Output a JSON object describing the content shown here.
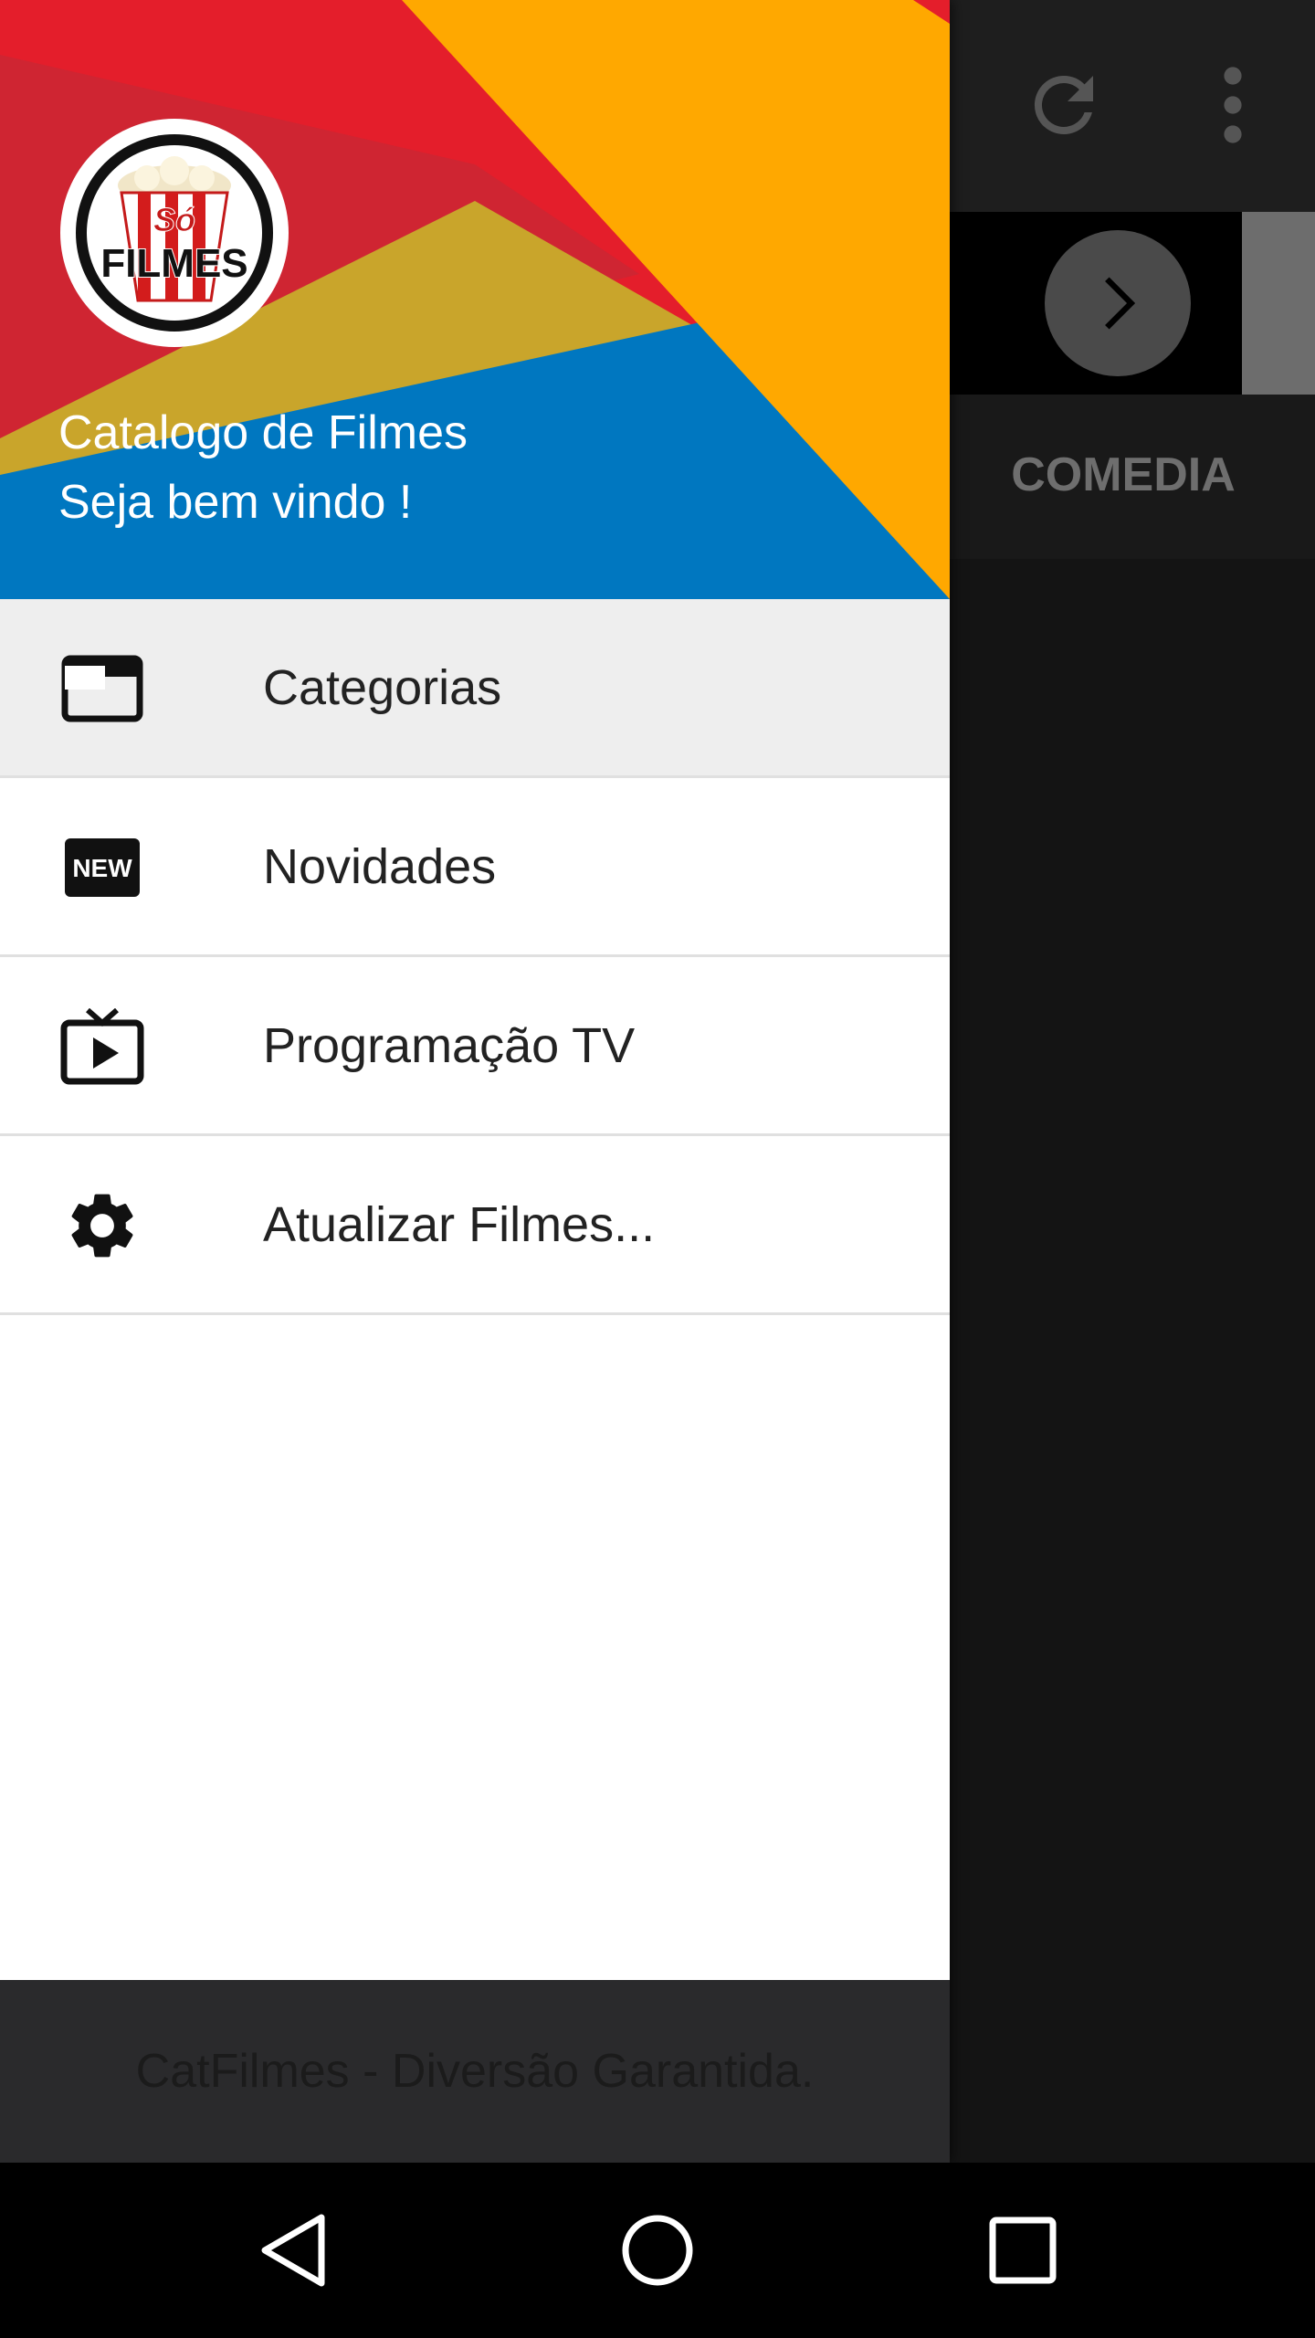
{
  "app": {
    "header_title": "Catalogo de Filmes",
    "header_subtitle": "Seja bem vindo !",
    "logo_text_top": "Só",
    "logo_text_bottom": "FILMES"
  },
  "menu": {
    "items": [
      {
        "label": "Categorias",
        "icon": "tab-icon",
        "active": true
      },
      {
        "label": "Novidades",
        "icon": "new-badge-icon",
        "active": false
      },
      {
        "label": "Programação TV",
        "icon": "live-tv-icon",
        "active": false
      },
      {
        "label": "Atualizar Filmes...",
        "icon": "gear-icon",
        "active": false
      }
    ]
  },
  "footer": {
    "text": "CatFilmes - Diversão Garantida."
  },
  "background_app": {
    "category_label": "COMEDIA",
    "toolbar_icons": [
      "refresh-icon",
      "more-vert-icon"
    ],
    "banner_button_icon": "chevron-right-icon"
  },
  "navbar": {
    "icons": [
      "back-icon",
      "home-icon",
      "recents-icon"
    ]
  },
  "colors": {
    "header_red": "#e41e2b",
    "header_orange": "#ffa800",
    "header_blue": "#0077c0",
    "header_gold": "#c9a52b",
    "drawer_footer": "#2a2a2c",
    "active_item": "#eeeeee"
  }
}
